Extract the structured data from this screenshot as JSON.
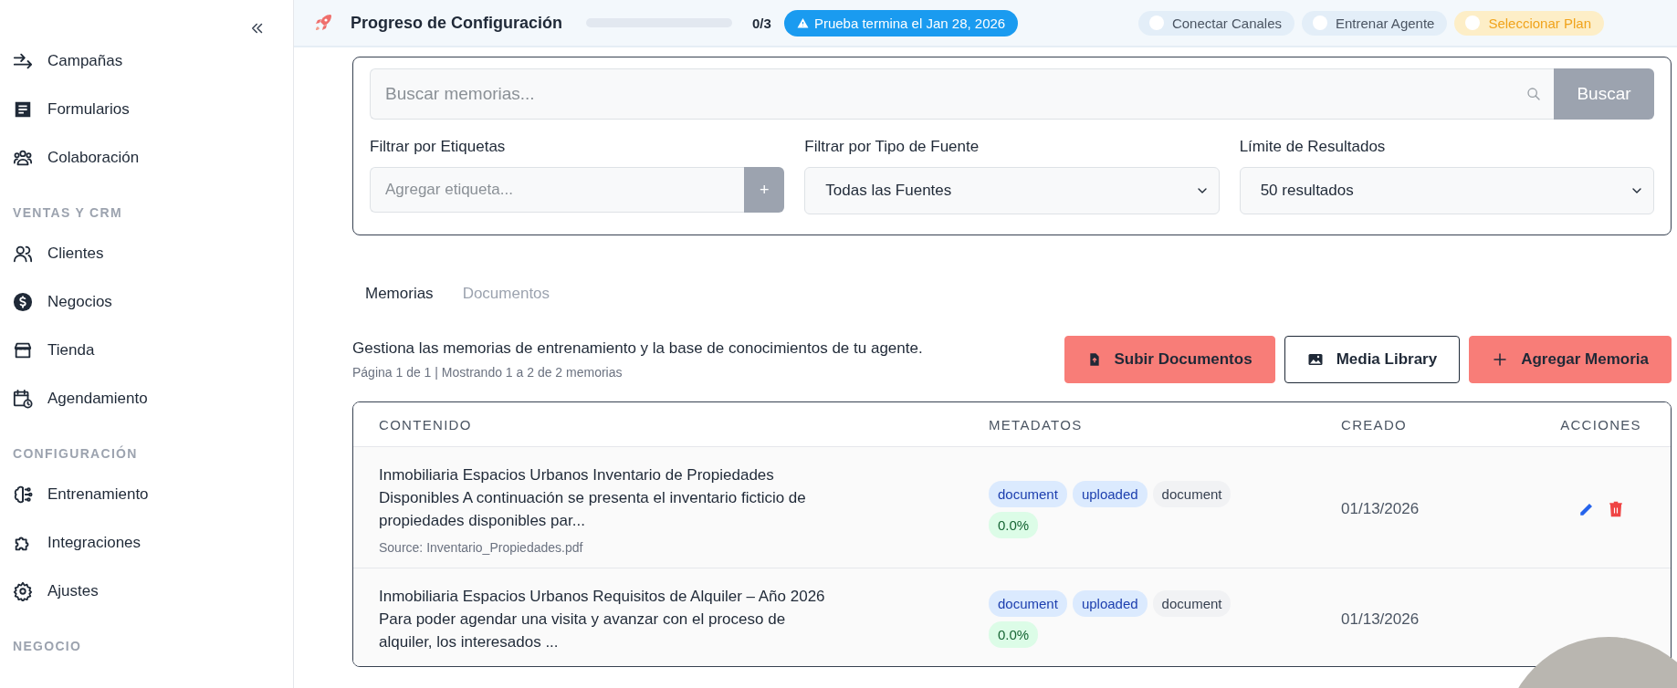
{
  "sidebar": {
    "sections": [
      {
        "items": [
          {
            "label": "Campañas"
          },
          {
            "label": "Formularios"
          },
          {
            "label": "Colaboración"
          }
        ]
      },
      {
        "heading": "VENTAS Y CRM",
        "items": [
          {
            "label": "Clientes"
          },
          {
            "label": "Negocios"
          },
          {
            "label": "Tienda"
          },
          {
            "label": "Agendamiento"
          }
        ]
      },
      {
        "heading": "CONFIGURACIÓN",
        "items": [
          {
            "label": "Entrenamiento"
          },
          {
            "label": "Integraciones"
          },
          {
            "label": "Ajustes"
          }
        ]
      },
      {
        "heading": "NEGOCIO"
      }
    ]
  },
  "setup_bar": {
    "title": "Progreso de Configuración",
    "level": 0,
    "count": "0/3",
    "trial_badge": "Prueba termina el Jan 28, 2026",
    "steps": [
      {
        "label": "Conectar Canales",
        "highlighted": false
      },
      {
        "label": "Entrenar Agente",
        "highlighted": false
      },
      {
        "label": "Seleccionar Plan",
        "highlighted": true
      }
    ]
  },
  "search": {
    "placeholder": "Buscar memorias...",
    "button": "Buscar",
    "filters": [
      {
        "kind": "tag-input",
        "label": "Filtrar por Etiquetas",
        "placeholder": "Agregar etiqueta...",
        "button": "+"
      },
      {
        "kind": "select",
        "label": "Filtrar por Tipo de Fuente",
        "value": "Todas las Fuentes"
      },
      {
        "kind": "select",
        "label": "Límite de Resultados",
        "value": "50 resultados"
      }
    ]
  },
  "tabs": [
    {
      "label": "Memorias",
      "selected": true
    },
    {
      "label": "Documentos",
      "selected": false
    }
  ],
  "description": "Gestiona las memorias de entrenamiento y la base de conocimientos de tu agente.",
  "pagination": "Página 1 de 1 | Mostrando 1 a 2 de 2 memorias",
  "actions": [
    {
      "label": "Subir Documentos",
      "kind": "upload"
    },
    {
      "label": "Media Library",
      "kind": "media"
    },
    {
      "label": "Agregar Memoria",
      "kind": "add"
    }
  ],
  "table": {
    "columns": [
      "CONTENIDO",
      "METADATOS",
      "CREADO",
      "ACCIONES"
    ],
    "rows": [
      {
        "content": "Inmobiliaria Espacios Urbanos Inventario de Propiedades Disponibles A continuación se presenta el inventario ficticio de propiedades disponibles par...",
        "source": "Source: Inventario_Propiedades.pdf",
        "tags": [
          {
            "text": "document",
            "kind": "type"
          },
          {
            "text": "uploaded",
            "kind": "status"
          },
          {
            "text": "document",
            "kind": "plain"
          },
          {
            "text": "0.0%",
            "kind": "score"
          }
        ],
        "created": "01/13/2026",
        "show_actions": true
      },
      {
        "content": "Inmobiliaria Espacios Urbanos Requisitos de Alquiler – Año 2026 Para poder agendar una visita y avanzar con el proceso de alquiler, los interesados ...",
        "tags": [
          {
            "text": "document",
            "kind": "type"
          },
          {
            "text": "uploaded",
            "kind": "status"
          },
          {
            "text": "document",
            "kind": "plain"
          },
          {
            "text": "0.0%",
            "kind": "score"
          }
        ],
        "created": "01/13/2026",
        "show_actions": false
      }
    ]
  }
}
